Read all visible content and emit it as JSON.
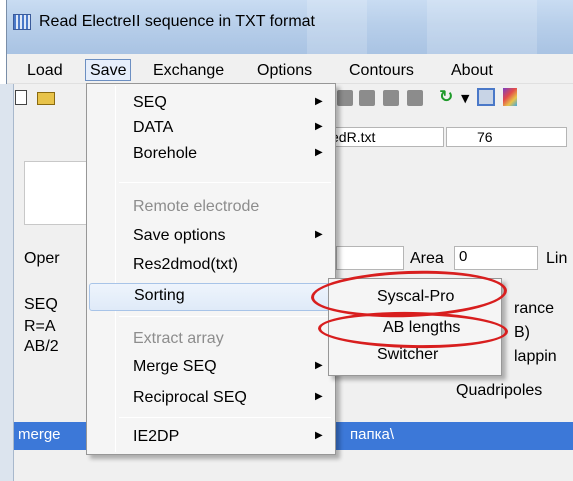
{
  "window": {
    "title": "Read ElectreII sequence in TXT format"
  },
  "menubar": {
    "items": [
      {
        "label": "Load"
      },
      {
        "label": "Save"
      },
      {
        "label": "Exchange"
      },
      {
        "label": "Options"
      },
      {
        "label": "Contours"
      },
      {
        "label": "About"
      }
    ]
  },
  "toolbar": {
    "file_value": "nergedR.txt",
    "number_value": "76"
  },
  "form": {
    "oper_label": "Oper",
    "area_label": "Area",
    "area_value": "0",
    "lin_label": "Lin",
    "seq_label": "SEQ",
    "r_label": "R=A",
    "ab_label": "AB/2",
    "rance_label": "rance",
    "b_label": "B)",
    "lappin_label": "lappin",
    "quadripoles_label": "Quadripoles"
  },
  "status": {
    "left_text": "merge",
    "right_text": "папка\\"
  },
  "save_menu": {
    "items": [
      {
        "label": "SEQ",
        "submenu": true,
        "enabled": true
      },
      {
        "label": "DATA",
        "submenu": true,
        "enabled": true
      },
      {
        "label": "Borehole",
        "submenu": true,
        "enabled": true
      },
      {
        "label": "Remote electrode",
        "submenu": false,
        "enabled": false
      },
      {
        "label": "Save options",
        "submenu": true,
        "enabled": true
      },
      {
        "label": "Res2dmod(txt)",
        "submenu": false,
        "enabled": true
      },
      {
        "label": "Sorting",
        "submenu": false,
        "enabled": true,
        "highlighted": true
      },
      {
        "label": "Extract array",
        "submenu": false,
        "enabled": false
      },
      {
        "label": "Merge SEQ",
        "submenu": true,
        "enabled": true
      },
      {
        "label": "Reciprocal SEQ",
        "submenu": true,
        "enabled": true
      },
      {
        "label": "IE2DP",
        "submenu": true,
        "enabled": true
      }
    ]
  },
  "sorting_submenu": {
    "items": [
      {
        "label": "Syscal-Pro"
      },
      {
        "label": "AB lengths"
      },
      {
        "label": "Switcher"
      }
    ]
  },
  "annotation_color": "#d81e1e",
  "accent_color": "#3c78d8"
}
